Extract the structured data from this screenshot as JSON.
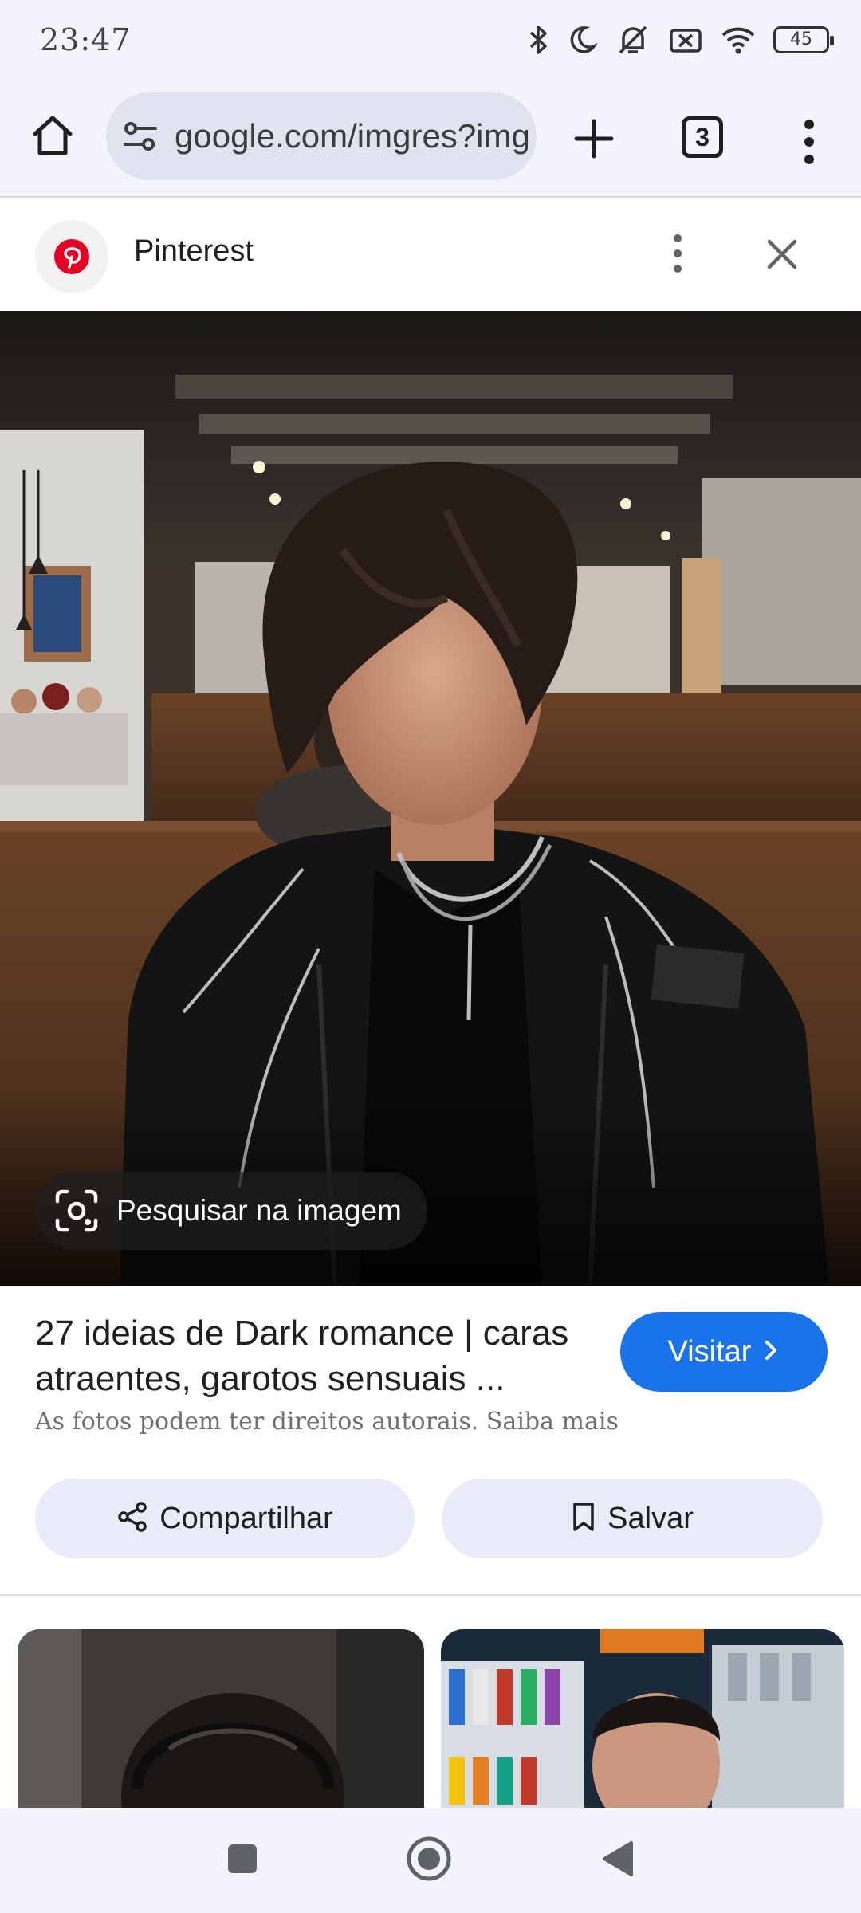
{
  "status_bar": {
    "time": "23:47",
    "battery": "45",
    "icons": [
      "bluetooth-icon",
      "moon-icon",
      "mute-vibrate-icon",
      "no-sim-icon",
      "wifi-icon",
      "battery-icon"
    ]
  },
  "browser": {
    "url": "google.com/imgres?img",
    "tab_count": "3",
    "icons": [
      "home-icon",
      "site-info-icon",
      "plus-icon",
      "tabs-icon",
      "more-vertical-icon"
    ]
  },
  "source": {
    "name": "Pinterest",
    "brand_color": "#e60023"
  },
  "image": {
    "lens_label": "Pesquisar na imagem"
  },
  "result": {
    "title": "27 ideias de Dark romance | caras atraentes, garotos sensuais ...",
    "visit_label": "Visitar",
    "copyright_text": "As fotos podem ter direitos autorais.",
    "learn_more": "Saiba mais",
    "share_label": "Compartilhar",
    "save_label": "Salvar",
    "accent_color": "#1a73e8"
  },
  "nav_bar": {
    "icons": [
      "recent-apps-icon",
      "home-circle-icon",
      "back-icon"
    ]
  }
}
